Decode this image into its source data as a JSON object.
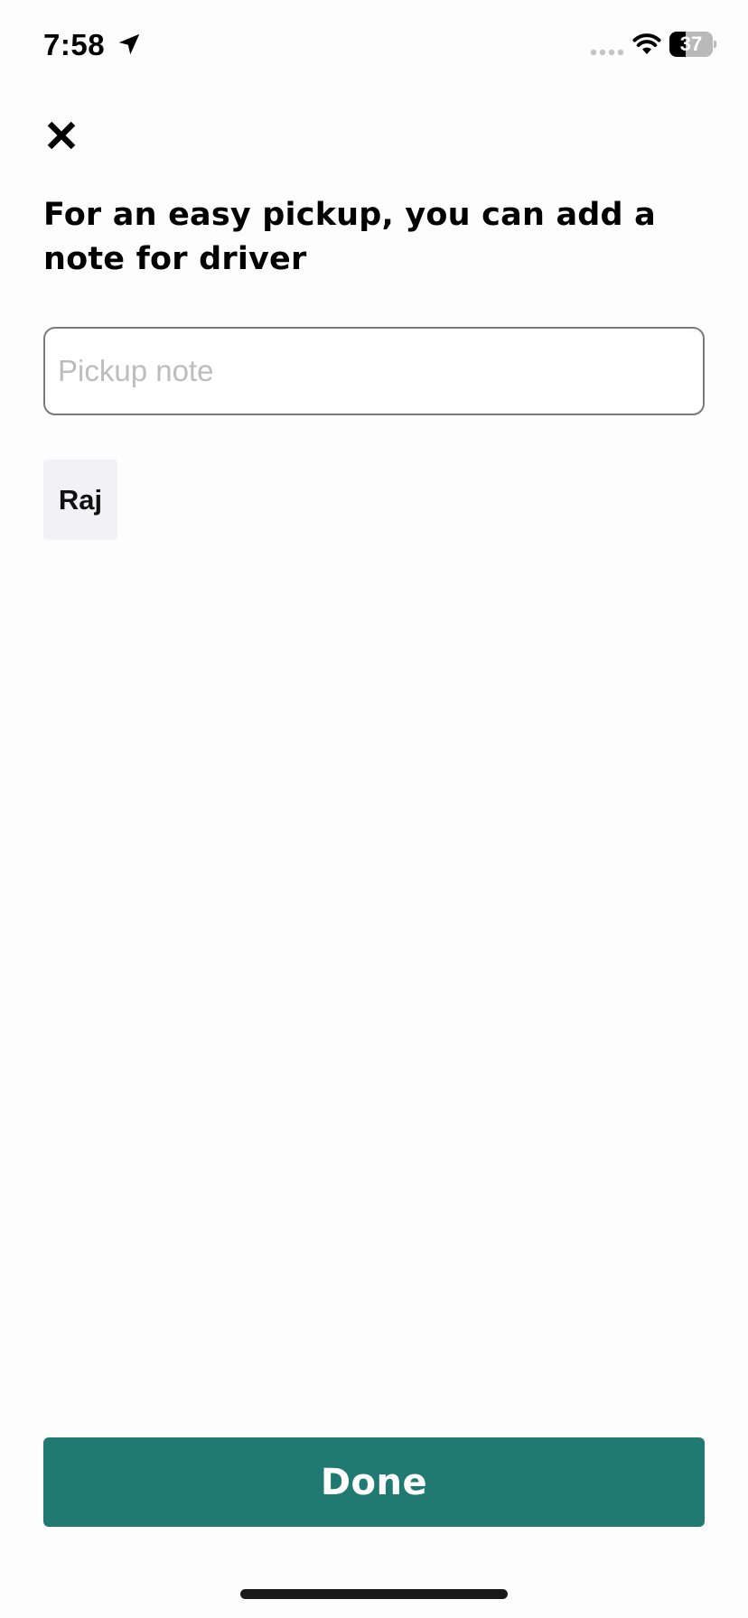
{
  "status_bar": {
    "time": "7:58",
    "battery_level": "37",
    "battery_fraction": 0.37
  },
  "icons": {
    "close": "close-icon",
    "location": "location-arrow-icon",
    "signal": "cellular-signal-icon",
    "wifi": "wifi-icon",
    "battery": "battery-icon"
  },
  "main": {
    "heading": "For an easy pickup, you can add a note for driver",
    "note_input": {
      "value": "",
      "placeholder": "Pickup note"
    },
    "suggestion_chips": [
      "Raj"
    ]
  },
  "footer": {
    "done_label": "Done"
  },
  "colors": {
    "primary": "#217a71",
    "chip_background": "#f1f1f6",
    "input_border": "#7a7a7a",
    "placeholder": "#bdbdbd"
  }
}
